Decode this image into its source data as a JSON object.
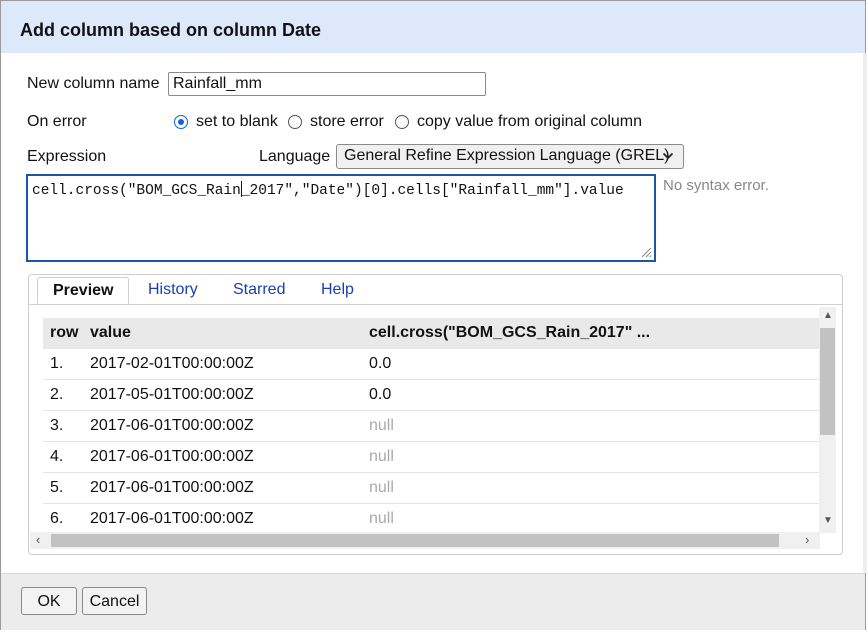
{
  "dialog": {
    "title": "Add column based on column Date",
    "new_column_label": "New column name",
    "new_column_value": "Rainfall_mm",
    "on_error_label": "On error",
    "on_error_options": [
      "set to blank",
      "store error",
      "copy value from original column"
    ],
    "on_error_selected": "set to blank",
    "expression_label": "Expression",
    "language_label": "Language",
    "language_value": "General Refine Expression Language (GREL)",
    "expression_before_caret": "cell.cross(\"BOM_GCS_Rain",
    "expression_after_caret": "_2017\",\"Date\")[0].cells[\"Rainfall_mm\"].value",
    "syntax_status": "No syntax error."
  },
  "tabs": [
    {
      "label": "Preview",
      "active": true
    },
    {
      "label": "History",
      "active": false
    },
    {
      "label": "Starred",
      "active": false
    },
    {
      "label": "Help",
      "active": false
    }
  ],
  "preview": {
    "columns": [
      "row",
      "value",
      "cell.cross(\"BOM_GCS_Rain_2017\" ..."
    ],
    "rows": [
      {
        "row": "1.",
        "value": "2017-02-01T00:00:00Z",
        "result": "0.0",
        "is_null": false
      },
      {
        "row": "2.",
        "value": "2017-05-01T00:00:00Z",
        "result": "0.0",
        "is_null": false
      },
      {
        "row": "3.",
        "value": "2017-06-01T00:00:00Z",
        "result": "null",
        "is_null": true
      },
      {
        "row": "4.",
        "value": "2017-06-01T00:00:00Z",
        "result": "null",
        "is_null": true
      },
      {
        "row": "5.",
        "value": "2017-06-01T00:00:00Z",
        "result": "null",
        "is_null": true
      },
      {
        "row": "6.",
        "value": "2017-06-01T00:00:00Z",
        "result": "null",
        "is_null": true
      }
    ]
  },
  "footer": {
    "ok_label": "OK",
    "cancel_label": "Cancel"
  },
  "colors": {
    "title_bar": "#dde9fb",
    "radio_accent": "#0a66d8",
    "tab_link": "#1a3fb3",
    "null_text": "#aaaaaa"
  }
}
